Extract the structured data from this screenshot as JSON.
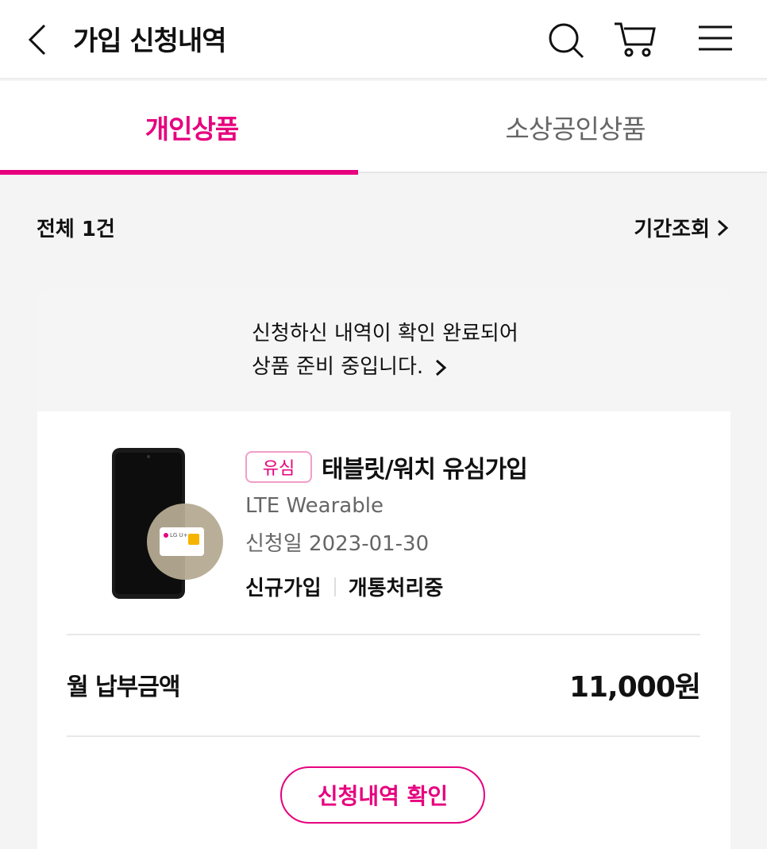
{
  "header": {
    "title": "가입 신청내역",
    "back_icon": "chevron-left-icon",
    "search_icon": "search-icon",
    "cart_icon": "cart-icon",
    "menu_icon": "hamburger-menu-icon"
  },
  "tabs": [
    {
      "label": "개인상품",
      "active": true
    },
    {
      "label": "소상공인상품",
      "active": false
    }
  ],
  "summary": {
    "total": "전체 1건",
    "period_label": "기간조회"
  },
  "card": {
    "notice_line1": "신청하신 내역이 확인 완료되어",
    "notice_line2": "상품 준비 중입니다.",
    "badge": "유심",
    "product_name": "태블릿/워치 유심가입",
    "plan_name": "LTE Wearable",
    "apply_date": "신청일 2023-01-30",
    "join_type": "신규가입",
    "status": "개통처리중",
    "fee_label": "월 납부금액",
    "fee_value": "11,000원",
    "confirm_label": "신청내역 확인",
    "sim_brand": "LG U+"
  },
  "colors": {
    "accent": "#e6007e",
    "background": "#f4f4f4"
  }
}
